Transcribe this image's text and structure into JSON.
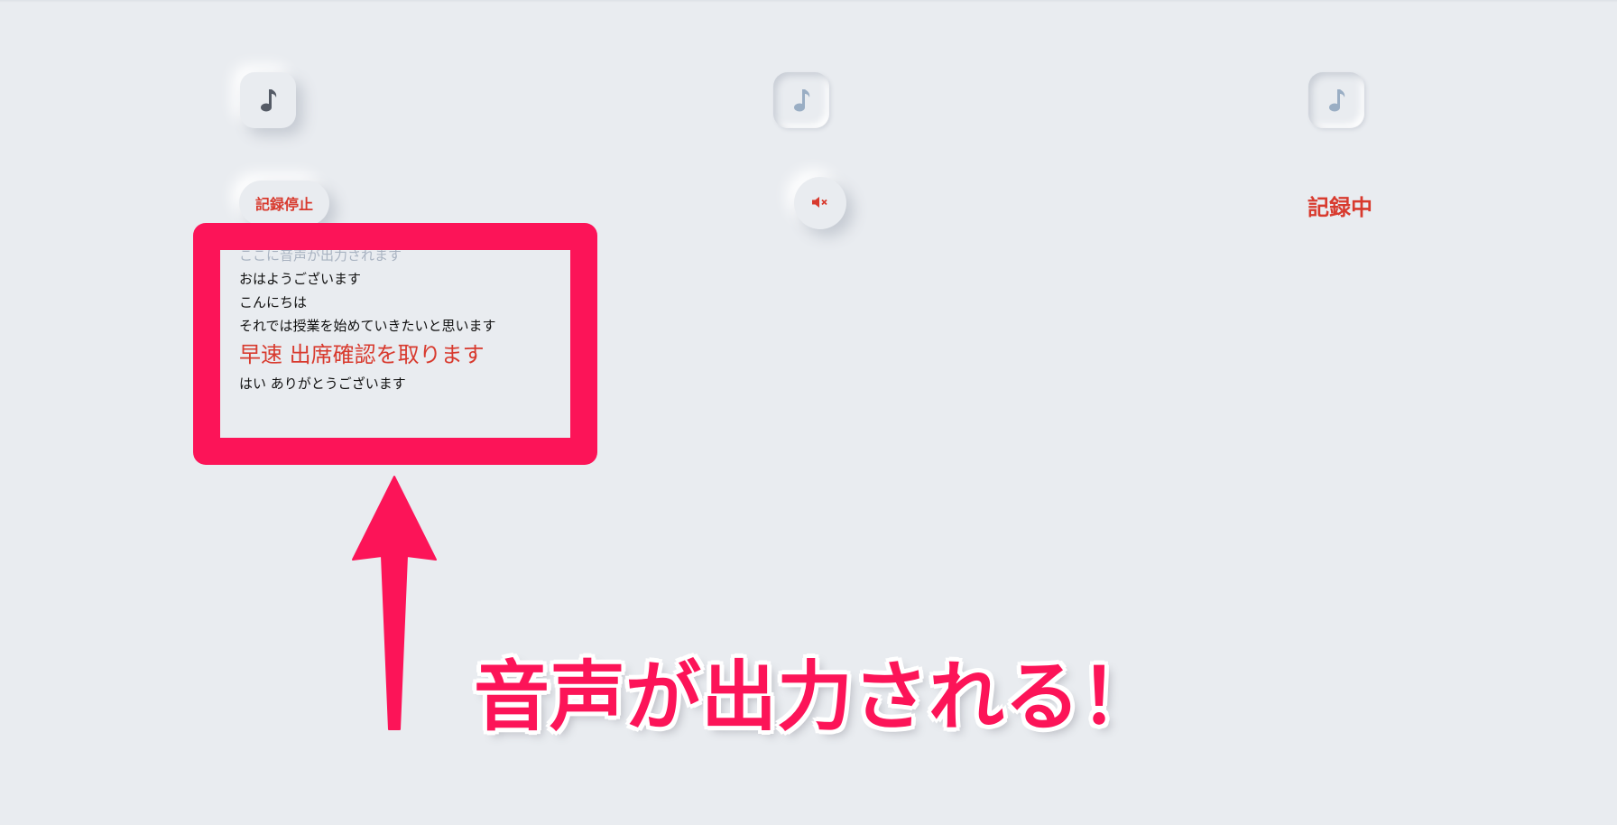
{
  "controls": {
    "stop_recording_label": "記録停止",
    "recording_status_label": "記録中"
  },
  "icons": {
    "music_note": "music-note-icon",
    "mute": "speaker-mute-icon"
  },
  "transcript": {
    "placeholder": "ここに音声が出力されます",
    "lines": [
      "おはようございます",
      "こんにちは",
      "それでは授業を始めていきたいと思います"
    ],
    "highlight_line": "早速 出席確認を取ります",
    "last_line": "はい ありがとうございます"
  },
  "annotation": {
    "caption": "音声が出力される！"
  },
  "colors": {
    "background": "#e9ecf0",
    "accent_red": "#d83a2e",
    "annotation_pink": "#fc1458",
    "icon_active": "#555b66",
    "icon_inactive": "#9aaec4"
  }
}
